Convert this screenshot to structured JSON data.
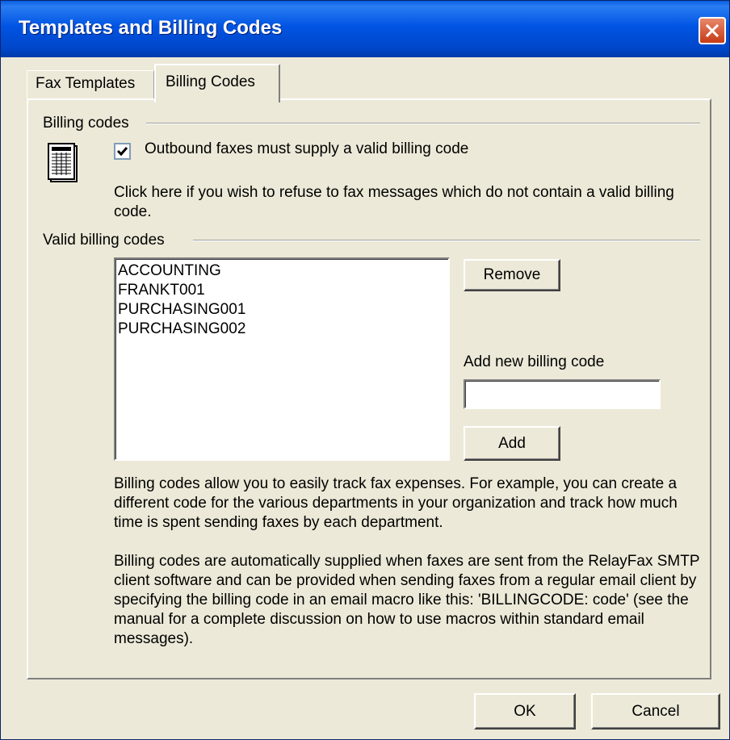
{
  "window": {
    "title": "Templates and Billing Codes"
  },
  "tabs": [
    {
      "label": "Fax Templates",
      "active": false
    },
    {
      "label": "Billing Codes",
      "active": true
    }
  ],
  "billing_codes_group": {
    "label": "Billing codes",
    "checkbox_label": "Outbound faxes must supply a valid billing code",
    "checkbox_checked": true,
    "description": "Click here if you wish to refuse to fax messages which do not contain a valid billing code."
  },
  "valid_codes_group": {
    "label": "Valid billing codes",
    "codes": [
      "ACCOUNTING",
      "FRANKT001",
      "PURCHASING001",
      "PURCHASING002"
    ],
    "remove_label": "Remove",
    "add_label_text": "Add new billing code",
    "add_input_value": "",
    "add_button_label": "Add"
  },
  "info_paragraphs": [
    "Billing codes allow you to easily track fax expenses.  For example, you can create a different code for the various departments in your organization and track how much time is spent sending faxes by each department.",
    "Billing codes are automatically supplied when faxes are sent from the RelayFax SMTP client software and can be provided when sending faxes from a regular email client by specifying the billing code in an email macro like this: 'BILLINGCODE: code' (see the manual for a complete discussion on how to use macros within standard email messages)."
  ],
  "footer": {
    "ok_label": "OK",
    "cancel_label": "Cancel"
  },
  "icons": {
    "close": "close-icon",
    "document": "document-icon",
    "checkmark": "checkmark-icon"
  },
  "colors": {
    "titlebar": "#0054e3",
    "dialog_bg": "#ece9d8",
    "close_button": "#c63a16"
  }
}
